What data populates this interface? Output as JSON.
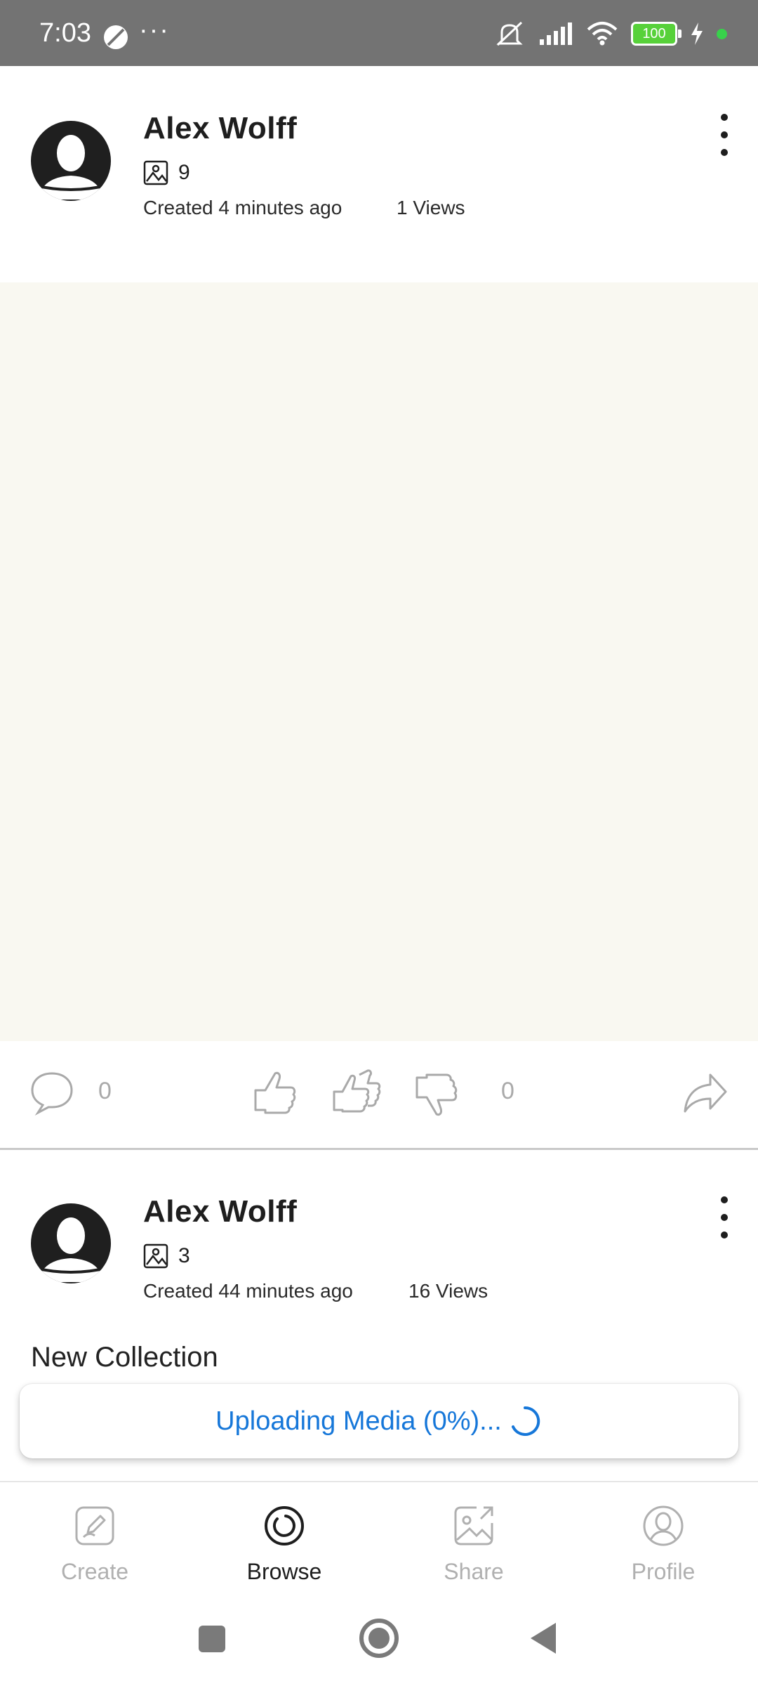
{
  "status_bar": {
    "time": "7:03",
    "more": "···",
    "battery": "100",
    "icons": [
      "dnd-circle-icon",
      "mute-bell-icon",
      "signal-icon",
      "wifi-icon",
      "battery-icon",
      "charging-icon"
    ]
  },
  "posts": [
    {
      "author": "Alex Wolff",
      "media_count": "9",
      "created": "Created 4 minutes ago",
      "views": "1 Views",
      "comments": "0",
      "votes": "0"
    },
    {
      "author": "Alex Wolff",
      "media_count": "3",
      "created": "Created 44 minutes ago",
      "views": "16 Views",
      "collection_title": "New Collection"
    }
  ],
  "toast": {
    "text": "Uploading Media  (0%)..."
  },
  "bottom_nav": {
    "tabs": [
      {
        "label": "Create",
        "icon": "edit-icon",
        "active": false
      },
      {
        "label": "Browse",
        "icon": "browse-icon",
        "active": true
      },
      {
        "label": "Share",
        "icon": "share-image-icon",
        "active": false
      },
      {
        "label": "Profile",
        "icon": "profile-icon",
        "active": false
      }
    ]
  },
  "colors": {
    "accent": "#1677d9",
    "status_bar": "#737373",
    "media_placeholder": "#f9f8f1",
    "inactive": "#b0b0b0"
  }
}
